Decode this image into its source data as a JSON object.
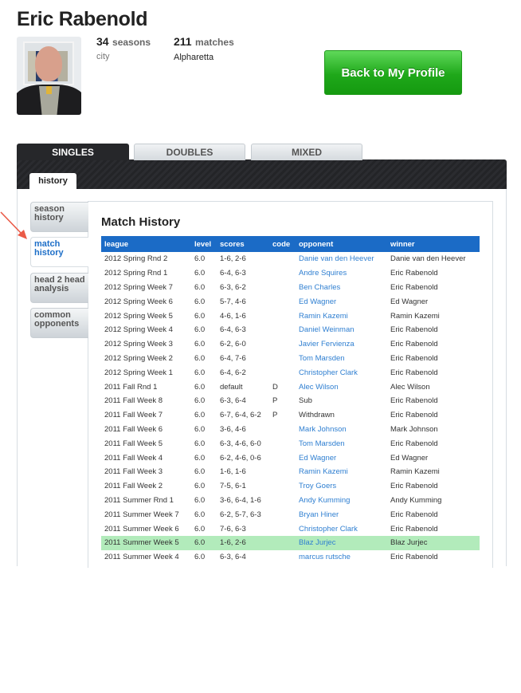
{
  "profile": {
    "name": "Eric Rabenold",
    "seasons_count": "34",
    "seasons_label": "seasons",
    "matches_count": "211",
    "matches_label": "matches",
    "city_label": "city",
    "city": "Alpharetta"
  },
  "back_button": "Back to My Profile",
  "tabs": [
    {
      "label": "SINGLES",
      "active": true
    },
    {
      "label": "DOUBLES",
      "active": false
    },
    {
      "label": "MIXED",
      "active": false
    }
  ],
  "subtab": "history",
  "side_tabs": [
    {
      "label": "season history",
      "active": false
    },
    {
      "label": "match history",
      "active": true
    },
    {
      "label": "head 2 head analysis",
      "active": false
    },
    {
      "label": "common opponents",
      "active": false
    }
  ],
  "match_history": {
    "title": "Match History",
    "columns": [
      "league",
      "level",
      "scores",
      "code",
      "opponent",
      "winner"
    ],
    "highlight_color": "#b2ebbb",
    "rows": [
      [
        "2012 Spring Rnd 2",
        "6.0",
        "1-6, 2-6",
        "",
        "Danie van den Heever",
        "Danie van den Heever"
      ],
      [
        "2012 Spring Rnd 1",
        "6.0",
        "6-4, 6-3",
        "",
        "Andre Squires",
        "Eric Rabenold"
      ],
      [
        "2012 Spring Week 7",
        "6.0",
        "6-3, 6-2",
        "",
        "Ben Charles",
        "Eric Rabenold"
      ],
      [
        "2012 Spring Week 6",
        "6.0",
        "5-7, 4-6",
        "",
        "Ed Wagner",
        "Ed Wagner"
      ],
      [
        "2012 Spring Week 5",
        "6.0",
        "4-6, 1-6",
        "",
        "Ramin Kazemi",
        "Ramin Kazemi"
      ],
      [
        "2012 Spring Week 4",
        "6.0",
        "6-4, 6-3",
        "",
        "Daniel Weinman",
        "Eric Rabenold"
      ],
      [
        "2012 Spring Week 3",
        "6.0",
        "6-2, 6-0",
        "",
        "Javier Fervienza",
        "Eric Rabenold"
      ],
      [
        "2012 Spring Week 2",
        "6.0",
        "6-4, 7-6",
        "",
        "Tom Marsden",
        "Eric Rabenold"
      ],
      [
        "2012 Spring Week 1",
        "6.0",
        "6-4, 6-2",
        "",
        "Christopher Clark",
        "Eric Rabenold"
      ],
      [
        "2011 Fall Rnd 1",
        "6.0",
        "default",
        "D",
        "Alec Wilson",
        "Alec Wilson"
      ],
      [
        "2011 Fall Week 8",
        "6.0",
        "6-3, 6-4",
        "P",
        "Sub",
        "Eric Rabenold"
      ],
      [
        "2011 Fall Week 7",
        "6.0",
        "6-7, 6-4, 6-2",
        "P",
        "Withdrawn",
        "Eric Rabenold"
      ],
      [
        "2011 Fall Week 6",
        "6.0",
        "3-6, 4-6",
        "",
        "Mark Johnson",
        "Mark Johnson"
      ],
      [
        "2011 Fall Week 5",
        "6.0",
        "6-3, 4-6, 6-0",
        "",
        "Tom Marsden",
        "Eric Rabenold"
      ],
      [
        "2011 Fall Week 4",
        "6.0",
        "6-2, 4-6, 0-6",
        "",
        "Ed Wagner",
        "Ed Wagner"
      ],
      [
        "2011 Fall Week 3",
        "6.0",
        "1-6, 1-6",
        "",
        "Ramin Kazemi",
        "Ramin Kazemi"
      ],
      [
        "2011 Fall Week 2",
        "6.0",
        "7-5, 6-1",
        "",
        "Troy Goers",
        "Eric Rabenold"
      ],
      [
        "2011 Summer Rnd 1",
        "6.0",
        "3-6, 6-4, 1-6",
        "",
        "Andy Kumming",
        "Andy Kumming"
      ],
      [
        "2011 Summer Week 7",
        "6.0",
        "6-2, 5-7, 6-3",
        "",
        "Bryan Hiner",
        "Eric Rabenold"
      ],
      [
        "2011 Summer Week 6",
        "6.0",
        "7-6, 6-3",
        "",
        "Christopher Clark",
        "Eric Rabenold"
      ],
      [
        "2011 Summer Week 5",
        "6.0",
        "1-6, 2-6",
        "",
        "Blaz Jurjec",
        "Blaz Jurjec"
      ],
      [
        "2011 Summer Week 4",
        "6.0",
        "6-3, 6-4",
        "",
        "marcus rutsche",
        "Eric Rabenold"
      ]
    ],
    "highlighted_row": 20,
    "unlinked_opponents": [
      "Sub",
      "Withdrawn"
    ]
  }
}
